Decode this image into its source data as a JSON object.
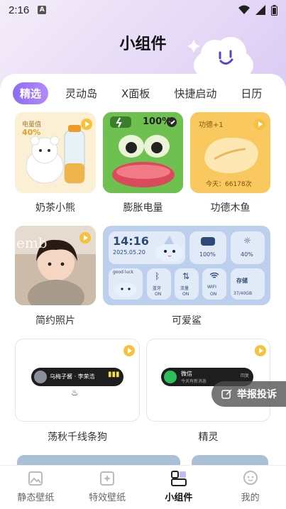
{
  "status": {
    "time": "2:16",
    "notif": "A"
  },
  "page_title": "小组件",
  "tabs": [
    {
      "label": "精选",
      "active": true
    },
    {
      "label": "灵动岛",
      "active": false
    },
    {
      "label": "X面板",
      "active": false
    },
    {
      "label": "快捷启动",
      "active": false
    },
    {
      "label": "日历",
      "active": false
    }
  ],
  "widgets": {
    "milk_tea": {
      "caption": "奶茶小熊",
      "tag": "电量值",
      "value": "40%"
    },
    "frog": {
      "caption": "膨胀电量",
      "battery": "100%"
    },
    "woodfish": {
      "caption": "功德木鱼",
      "merit": "功德+1",
      "today": "今天：66178次"
    },
    "photo": {
      "caption": "简约照片",
      "watermark": "emb"
    },
    "shark": {
      "caption": "可爱鲨",
      "time": "14:16",
      "date": "2025.05.20",
      "battery": "100%",
      "brightness": "40%",
      "good_luck": "good luck",
      "bluetooth": "蓝牙",
      "bluetooth_state": "ON",
      "data": "流量",
      "data_state": "ON",
      "wifi": "WIFI",
      "wifi_state": "ON",
      "storage": "存储",
      "storage_value": "37/40GB"
    },
    "autumn": {
      "caption": "荡秋千线条狗",
      "pill_text": "乌梅子酱 · 李荣浩"
    },
    "spirit": {
      "caption": "精灵",
      "pill_title": "微信",
      "pill_sub": "今天有新消息",
      "pill_tag": "回复"
    }
  },
  "report_button": "举报投诉",
  "nav": [
    {
      "label": "静态壁纸",
      "active": false
    },
    {
      "label": "特效壁纸",
      "active": false
    },
    {
      "label": "小组件",
      "active": true
    },
    {
      "label": "我的",
      "active": false
    }
  ],
  "colors": {
    "accent": "#8b6df5",
    "badge": "#f6c23c",
    "panel_blue": "#bcd0ee"
  }
}
